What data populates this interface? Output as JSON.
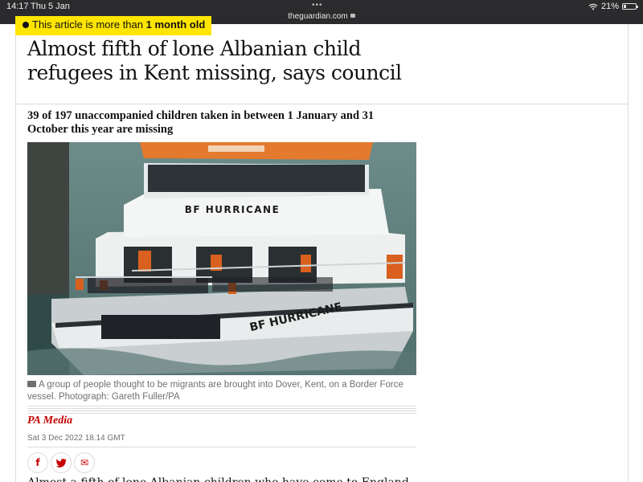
{
  "status_bar": {
    "time": "14:17",
    "date": "Thu 5 Jan",
    "url": "theguardian.com",
    "battery_percent": "21%",
    "battery_level": 0.21
  },
  "article": {
    "age_warning_prefix": "This article is more than ",
    "age_warning_emphasis": "1 month old",
    "headline": "Almost fifth of lone Albanian child refugees in Kent missing, says council",
    "standfirst": "39 of 197 unaccompanied children taken in between 1 January and 31 October this year are missing",
    "photo": {
      "boat_name": "BF HURRICANE",
      "caption": "A group of people thought to be migrants are brought into Dover, Kent, on a Border Force vessel. Photograph: Gareth Fuller/PA"
    },
    "byline": "PA Media",
    "dateline": "Sat 3 Dec 2022 18.14 GMT",
    "share": {
      "facebook": "f",
      "twitter": "t",
      "email": "✉"
    },
    "body_first_line": "Almost a fifth of lone Albanian children who have come to England"
  },
  "colors": {
    "brand_red": "#c70000",
    "warning_yellow": "#ffe500",
    "status_bar": "#2b2b2d"
  },
  "icons": [
    "clock-icon",
    "camera-icon",
    "facebook-icon",
    "twitter-icon",
    "email-icon",
    "wifi-icon",
    "battery-icon",
    "lock-icon"
  ]
}
